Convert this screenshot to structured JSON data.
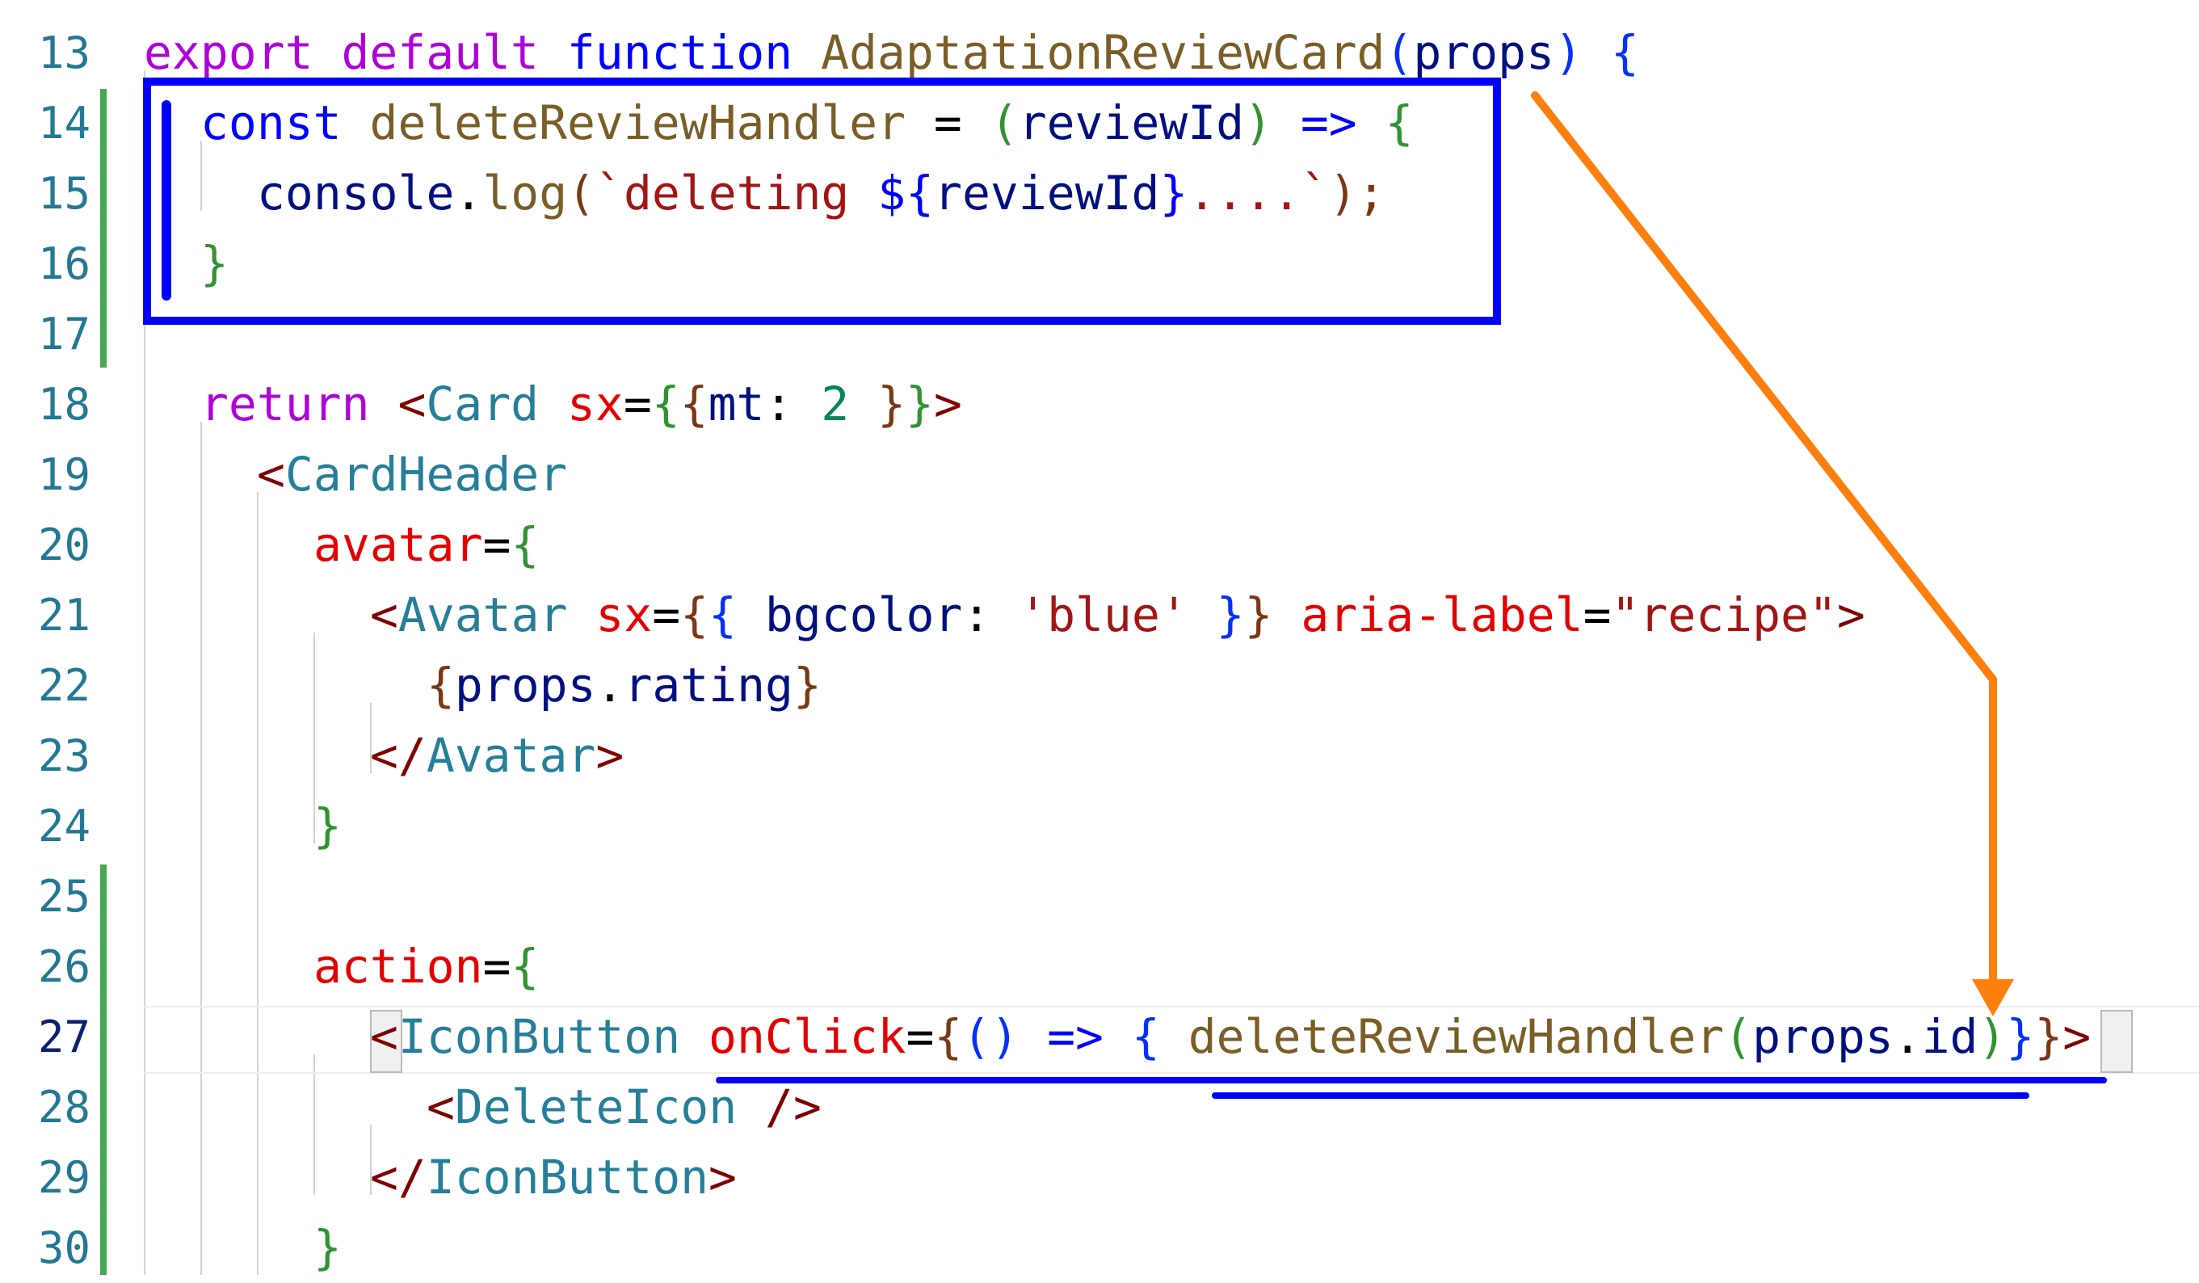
{
  "editor": {
    "current_line": "27",
    "lines": [
      {
        "num": "13"
      },
      {
        "num": "14"
      },
      {
        "num": "15"
      },
      {
        "num": "16"
      },
      {
        "num": "17"
      },
      {
        "num": "18"
      },
      {
        "num": "19"
      },
      {
        "num": "20"
      },
      {
        "num": "21"
      },
      {
        "num": "22"
      },
      {
        "num": "23"
      },
      {
        "num": "24"
      },
      {
        "num": "25"
      },
      {
        "num": "26"
      },
      {
        "num": "27"
      },
      {
        "num": "28"
      },
      {
        "num": "29"
      },
      {
        "num": "30"
      }
    ],
    "code": {
      "l13": {
        "export": "export",
        "default": "default",
        "function": "function",
        "name": "AdaptationReviewCard",
        "open_paren": "(",
        "param": "props",
        "close_paren": ")",
        "brace": "{"
      },
      "l14": {
        "const": "const",
        "name": "deleteReviewHandler",
        "eq": "=",
        "open_paren": "(",
        "param": "reviewId",
        "close_paren": ")",
        "arrow": "=>",
        "brace": "{"
      },
      "l15": {
        "obj": "console",
        "dot": ".",
        "method": "log",
        "open_paren": "(",
        "tpl_start": "`deleting ",
        "interp_open": "${",
        "interp_var": "reviewId",
        "interp_close": "}",
        "tpl_end": "....`",
        "close": ");"
      },
      "l16": {
        "brace": "}"
      },
      "l18": {
        "return": "return",
        "lt": "<",
        "tag": "Card",
        "attr": "sx",
        "eq": "=",
        "br_outer_open": "{",
        "br_inner_open": "{",
        "key": "mt",
        "colon": ":",
        "value": "2",
        "br_inner_close": "}",
        "br_outer_close": "}",
        "gt": ">"
      },
      "l19": {
        "lt": "<",
        "tag": "CardHeader"
      },
      "l20": {
        "attr": "avatar",
        "eq": "=",
        "brace": "{"
      },
      "l21": {
        "lt": "<",
        "tag": "Avatar",
        "attr": "sx",
        "eq": "=",
        "br_outer_open": "{",
        "br_inner_open": "{",
        "key": "bgcolor",
        "colon": ":",
        "value": "'blue'",
        "br_inner_close": "}",
        "br_outer_close": "}",
        "attr2": "aria-label",
        "eq2": "=",
        "value2": "\"recipe\"",
        "gt": ">"
      },
      "l22": {
        "open": "{",
        "obj": "props",
        "dot": ".",
        "prop": "rating",
        "close": "}"
      },
      "l23": {
        "lt": "</",
        "tag": "Avatar",
        "gt": ">"
      },
      "l24": {
        "brace": "}"
      },
      "l26": {
        "attr": "action",
        "eq": "=",
        "brace": "{"
      },
      "l27": {
        "lt": "<",
        "tag": "IconButton",
        "attr": "onClick",
        "eq": "=",
        "br_outer_open": "{",
        "parens": "()",
        "arrow": "=>",
        "br_inner_open": "{",
        "call": "deleteReviewHandler",
        "call_open": "(",
        "obj": "props",
        "dot": ".",
        "prop": "id",
        "call_close": ")",
        "br_inner_close": "}",
        "br_outer_close": "}",
        "gt": ">"
      },
      "l28": {
        "lt": "<",
        "tag": "DeleteIcon",
        "close": "/>"
      },
      "l29": {
        "lt": "</",
        "tag": "IconButton",
        "gt": ">"
      },
      "l30": {
        "brace": "}"
      }
    }
  },
  "annotations": {
    "box_color": "#0000ff",
    "arrow_color": "#ff7f0e",
    "underline_color": "#0000ff"
  }
}
